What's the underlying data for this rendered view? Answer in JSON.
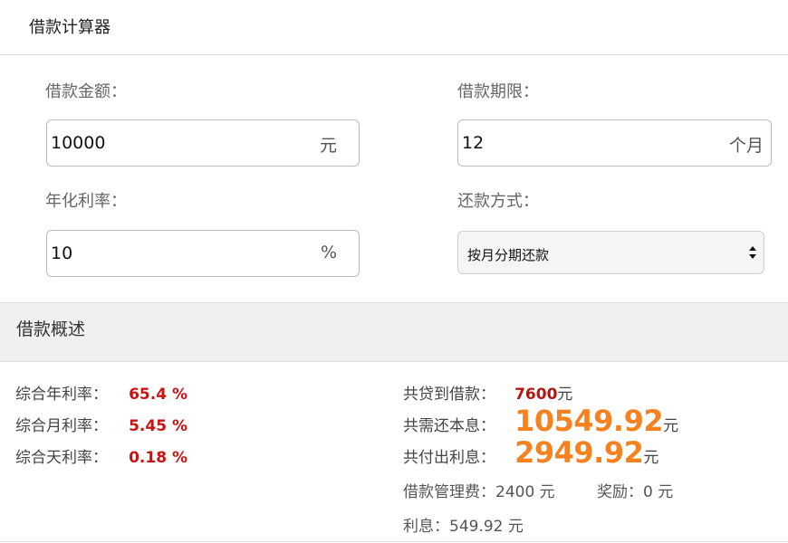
{
  "header": {
    "title": "借款计算器"
  },
  "form": {
    "amount_label": "借款金额：",
    "amount_value": "10000",
    "amount_unit": "元",
    "term_label": "借款期限：",
    "term_value": "12",
    "term_unit": "个月",
    "rate_label": "年化利率：",
    "rate_value": "10",
    "rate_unit": "%",
    "method_label": "还款方式：",
    "method_value": "按月分期还款"
  },
  "section": {
    "title": "借款概述"
  },
  "summary": {
    "annual_label": "综合年利率：",
    "annual_value": "65.4 %",
    "monthly_label": "综合月利率：",
    "monthly_value": "5.45 %",
    "daily_label": "综合天利率：",
    "daily_value": "0.18 %",
    "received_label": "共贷到借款：",
    "received_value": "7600",
    "received_unit": "元",
    "total_label": "共需还本息：",
    "total_value": "10549.92",
    "total_unit": "元",
    "interest_paid_label": "共付出利息：",
    "interest_paid_value": "2949.92",
    "interest_paid_unit": "元",
    "fee_text": "借款管理费：2400 元",
    "reward_text": "奖励：0 元",
    "interest_text": "利息：549.92 元"
  },
  "colors": {
    "rate_red": "#cc1111",
    "received_red": "#b8130e",
    "highlight_orange": "#f5821f"
  }
}
